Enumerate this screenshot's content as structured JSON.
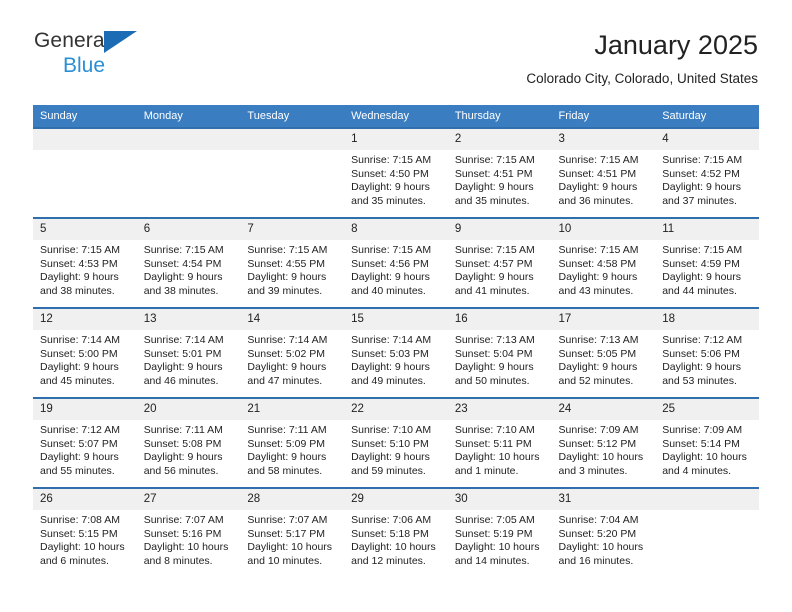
{
  "brand": {
    "line1": "General",
    "line2": "Blue",
    "triangle_icon": "triangle-logo-icon",
    "accent_dark": "#1b6cb5",
    "accent_light": "#2a8fd4"
  },
  "header": {
    "title": "January 2025",
    "subtitle": "Colorado City, Colorado, United States"
  },
  "theme": {
    "header_row_bg": "#3a7dc0",
    "day_number_bg": "#f0f0f0",
    "row_divider": "#2f6fae",
    "cell_bg": "#ffffff",
    "text": "#222222"
  },
  "weekday_headers": [
    "Sunday",
    "Monday",
    "Tuesday",
    "Wednesday",
    "Thursday",
    "Friday",
    "Saturday"
  ],
  "weeks": [
    [
      {
        "day": "",
        "sunrise": "",
        "sunset": "",
        "daylight_line1": "",
        "daylight_line2": "",
        "empty": true
      },
      {
        "day": "",
        "sunrise": "",
        "sunset": "",
        "daylight_line1": "",
        "daylight_line2": "",
        "empty": true
      },
      {
        "day": "",
        "sunrise": "",
        "sunset": "",
        "daylight_line1": "",
        "daylight_line2": "",
        "empty": true
      },
      {
        "day": "1",
        "sunrise": "Sunrise: 7:15 AM",
        "sunset": "Sunset: 4:50 PM",
        "daylight_line1": "Daylight: 9 hours",
        "daylight_line2": "and 35 minutes."
      },
      {
        "day": "2",
        "sunrise": "Sunrise: 7:15 AM",
        "sunset": "Sunset: 4:51 PM",
        "daylight_line1": "Daylight: 9 hours",
        "daylight_line2": "and 35 minutes."
      },
      {
        "day": "3",
        "sunrise": "Sunrise: 7:15 AM",
        "sunset": "Sunset: 4:51 PM",
        "daylight_line1": "Daylight: 9 hours",
        "daylight_line2": "and 36 minutes."
      },
      {
        "day": "4",
        "sunrise": "Sunrise: 7:15 AM",
        "sunset": "Sunset: 4:52 PM",
        "daylight_line1": "Daylight: 9 hours",
        "daylight_line2": "and 37 minutes."
      }
    ],
    [
      {
        "day": "5",
        "sunrise": "Sunrise: 7:15 AM",
        "sunset": "Sunset: 4:53 PM",
        "daylight_line1": "Daylight: 9 hours",
        "daylight_line2": "and 38 minutes."
      },
      {
        "day": "6",
        "sunrise": "Sunrise: 7:15 AM",
        "sunset": "Sunset: 4:54 PM",
        "daylight_line1": "Daylight: 9 hours",
        "daylight_line2": "and 38 minutes."
      },
      {
        "day": "7",
        "sunrise": "Sunrise: 7:15 AM",
        "sunset": "Sunset: 4:55 PM",
        "daylight_line1": "Daylight: 9 hours",
        "daylight_line2": "and 39 minutes."
      },
      {
        "day": "8",
        "sunrise": "Sunrise: 7:15 AM",
        "sunset": "Sunset: 4:56 PM",
        "daylight_line1": "Daylight: 9 hours",
        "daylight_line2": "and 40 minutes."
      },
      {
        "day": "9",
        "sunrise": "Sunrise: 7:15 AM",
        "sunset": "Sunset: 4:57 PM",
        "daylight_line1": "Daylight: 9 hours",
        "daylight_line2": "and 41 minutes."
      },
      {
        "day": "10",
        "sunrise": "Sunrise: 7:15 AM",
        "sunset": "Sunset: 4:58 PM",
        "daylight_line1": "Daylight: 9 hours",
        "daylight_line2": "and 43 minutes."
      },
      {
        "day": "11",
        "sunrise": "Sunrise: 7:15 AM",
        "sunset": "Sunset: 4:59 PM",
        "daylight_line1": "Daylight: 9 hours",
        "daylight_line2": "and 44 minutes."
      }
    ],
    [
      {
        "day": "12",
        "sunrise": "Sunrise: 7:14 AM",
        "sunset": "Sunset: 5:00 PM",
        "daylight_line1": "Daylight: 9 hours",
        "daylight_line2": "and 45 minutes."
      },
      {
        "day": "13",
        "sunrise": "Sunrise: 7:14 AM",
        "sunset": "Sunset: 5:01 PM",
        "daylight_line1": "Daylight: 9 hours",
        "daylight_line2": "and 46 minutes."
      },
      {
        "day": "14",
        "sunrise": "Sunrise: 7:14 AM",
        "sunset": "Sunset: 5:02 PM",
        "daylight_line1": "Daylight: 9 hours",
        "daylight_line2": "and 47 minutes."
      },
      {
        "day": "15",
        "sunrise": "Sunrise: 7:14 AM",
        "sunset": "Sunset: 5:03 PM",
        "daylight_line1": "Daylight: 9 hours",
        "daylight_line2": "and 49 minutes."
      },
      {
        "day": "16",
        "sunrise": "Sunrise: 7:13 AM",
        "sunset": "Sunset: 5:04 PM",
        "daylight_line1": "Daylight: 9 hours",
        "daylight_line2": "and 50 minutes."
      },
      {
        "day": "17",
        "sunrise": "Sunrise: 7:13 AM",
        "sunset": "Sunset: 5:05 PM",
        "daylight_line1": "Daylight: 9 hours",
        "daylight_line2": "and 52 minutes."
      },
      {
        "day": "18",
        "sunrise": "Sunrise: 7:12 AM",
        "sunset": "Sunset: 5:06 PM",
        "daylight_line1": "Daylight: 9 hours",
        "daylight_line2": "and 53 minutes."
      }
    ],
    [
      {
        "day": "19",
        "sunrise": "Sunrise: 7:12 AM",
        "sunset": "Sunset: 5:07 PM",
        "daylight_line1": "Daylight: 9 hours",
        "daylight_line2": "and 55 minutes."
      },
      {
        "day": "20",
        "sunrise": "Sunrise: 7:11 AM",
        "sunset": "Sunset: 5:08 PM",
        "daylight_line1": "Daylight: 9 hours",
        "daylight_line2": "and 56 minutes."
      },
      {
        "day": "21",
        "sunrise": "Sunrise: 7:11 AM",
        "sunset": "Sunset: 5:09 PM",
        "daylight_line1": "Daylight: 9 hours",
        "daylight_line2": "and 58 minutes."
      },
      {
        "day": "22",
        "sunrise": "Sunrise: 7:10 AM",
        "sunset": "Sunset: 5:10 PM",
        "daylight_line1": "Daylight: 9 hours",
        "daylight_line2": "and 59 minutes."
      },
      {
        "day": "23",
        "sunrise": "Sunrise: 7:10 AM",
        "sunset": "Sunset: 5:11 PM",
        "daylight_line1": "Daylight: 10 hours",
        "daylight_line2": "and 1 minute."
      },
      {
        "day": "24",
        "sunrise": "Sunrise: 7:09 AM",
        "sunset": "Sunset: 5:12 PM",
        "daylight_line1": "Daylight: 10 hours",
        "daylight_line2": "and 3 minutes."
      },
      {
        "day": "25",
        "sunrise": "Sunrise: 7:09 AM",
        "sunset": "Sunset: 5:14 PM",
        "daylight_line1": "Daylight: 10 hours",
        "daylight_line2": "and 4 minutes."
      }
    ],
    [
      {
        "day": "26",
        "sunrise": "Sunrise: 7:08 AM",
        "sunset": "Sunset: 5:15 PM",
        "daylight_line1": "Daylight: 10 hours",
        "daylight_line2": "and 6 minutes."
      },
      {
        "day": "27",
        "sunrise": "Sunrise: 7:07 AM",
        "sunset": "Sunset: 5:16 PM",
        "daylight_line1": "Daylight: 10 hours",
        "daylight_line2": "and 8 minutes."
      },
      {
        "day": "28",
        "sunrise": "Sunrise: 7:07 AM",
        "sunset": "Sunset: 5:17 PM",
        "daylight_line1": "Daylight: 10 hours",
        "daylight_line2": "and 10 minutes."
      },
      {
        "day": "29",
        "sunrise": "Sunrise: 7:06 AM",
        "sunset": "Sunset: 5:18 PM",
        "daylight_line1": "Daylight: 10 hours",
        "daylight_line2": "and 12 minutes."
      },
      {
        "day": "30",
        "sunrise": "Sunrise: 7:05 AM",
        "sunset": "Sunset: 5:19 PM",
        "daylight_line1": "Daylight: 10 hours",
        "daylight_line2": "and 14 minutes."
      },
      {
        "day": "31",
        "sunrise": "Sunrise: 7:04 AM",
        "sunset": "Sunset: 5:20 PM",
        "daylight_line1": "Daylight: 10 hours",
        "daylight_line2": "and 16 minutes."
      },
      {
        "day": "",
        "sunrise": "",
        "sunset": "",
        "daylight_line1": "",
        "daylight_line2": "",
        "empty": true
      }
    ]
  ]
}
